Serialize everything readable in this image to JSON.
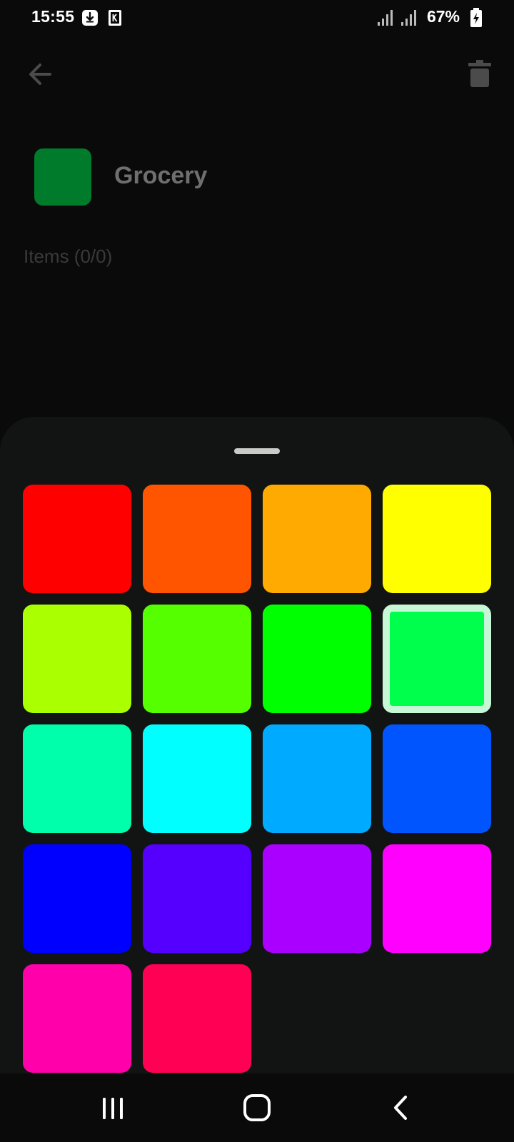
{
  "status_bar": {
    "time": "15:55",
    "battery": "67%",
    "icons": [
      "download-notification-icon",
      "k-app-notification-icon",
      "signal-icon",
      "signal-icon",
      "battery-charging-icon"
    ]
  },
  "header": {
    "back_icon": "arrow-left-icon",
    "delete_icon": "trash-icon"
  },
  "list": {
    "title": "Grocery",
    "color": "#007a2b",
    "items_label": "Items (0/0)"
  },
  "color_picker": {
    "selected_color": "#00ff4d",
    "swatches": [
      "#ff0000",
      "#ff5500",
      "#ffaa00",
      "#ffff00",
      "#aaff00",
      "#55ff00",
      "#00ff00",
      "#00ff4d",
      "#00ffaa",
      "#00ffff",
      "#00aaff",
      "#0055ff",
      "#0000ff",
      "#5500ff",
      "#aa00ff",
      "#ff00ff",
      "#ff00aa",
      "#ff0055"
    ]
  },
  "nav_bar": {
    "icons": [
      "recent-apps-icon",
      "home-icon",
      "back-icon"
    ]
  }
}
